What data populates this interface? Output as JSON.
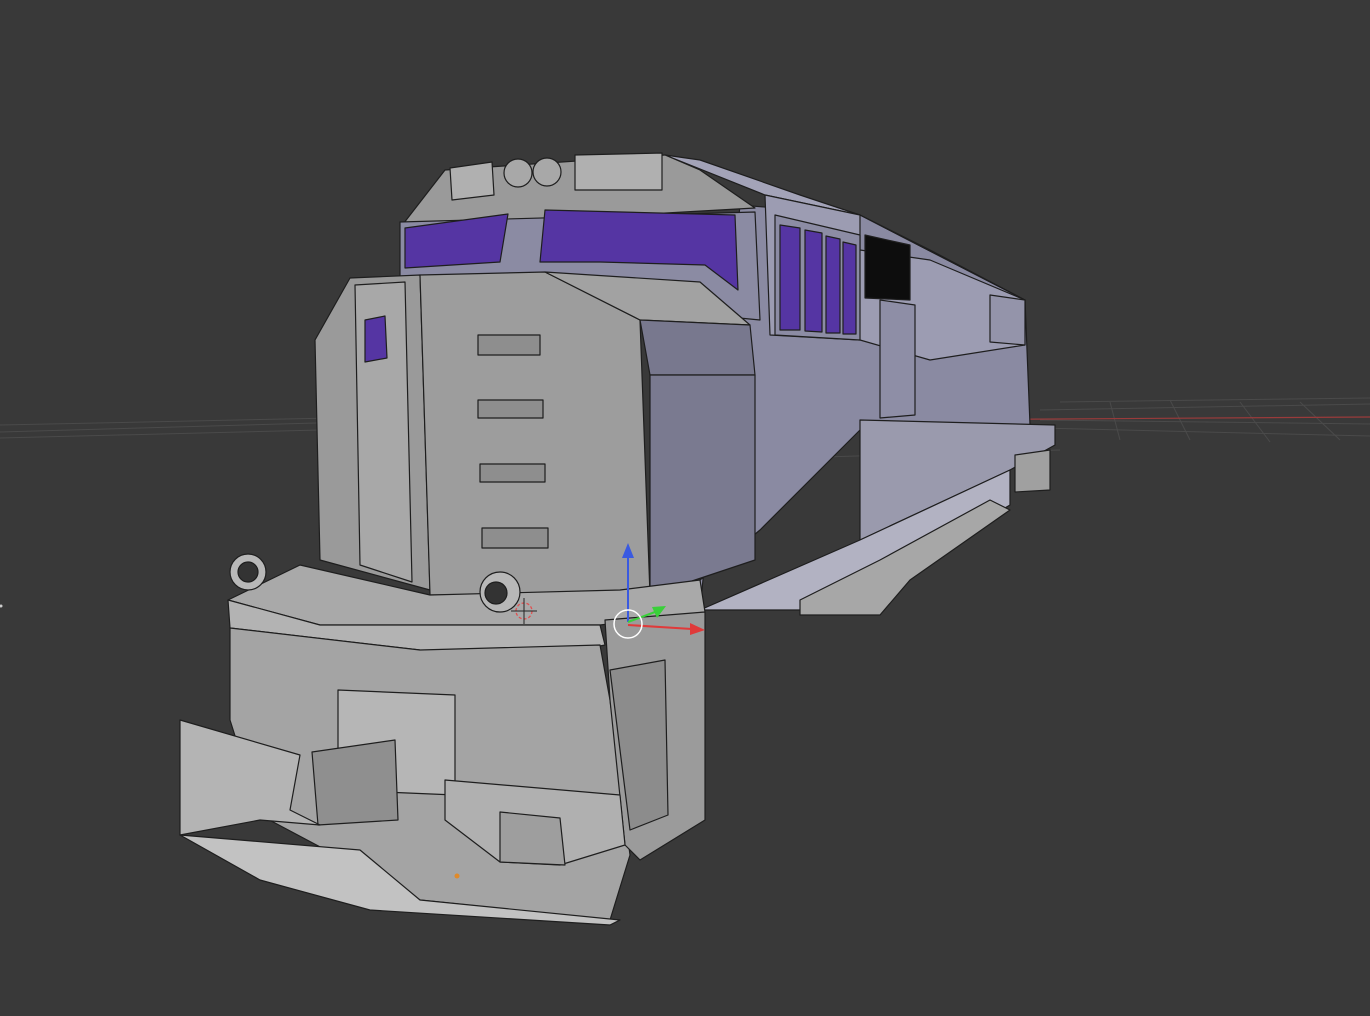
{
  "viewport": {
    "background": "#393939",
    "object": "locomotive-mesh",
    "shading": "solid-with-wireframe",
    "colors": {
      "body": "#8a8aa2",
      "body_light": "#a9a9bd",
      "body_dark": "#6e6e84",
      "gray": "#9a9a9a",
      "gray_light": "#b4b4b4",
      "gray_dark": "#7a7a7a",
      "window": "#5535a3",
      "edge": "#1e1e1e",
      "grid": "#4a4a4a",
      "x_axis": "#9a3b3b",
      "gizmo_x": "#e03a3a",
      "gizmo_y": "#3ad03a",
      "gizmo_z": "#3a5ae0",
      "origin": "#e08a2a"
    },
    "gizmo": {
      "type": "translate-manipulator",
      "axes": [
        "x-axis-arrow",
        "y-axis-arrow",
        "z-axis-arrow"
      ]
    },
    "cursor_3d": "3d-cursor"
  }
}
